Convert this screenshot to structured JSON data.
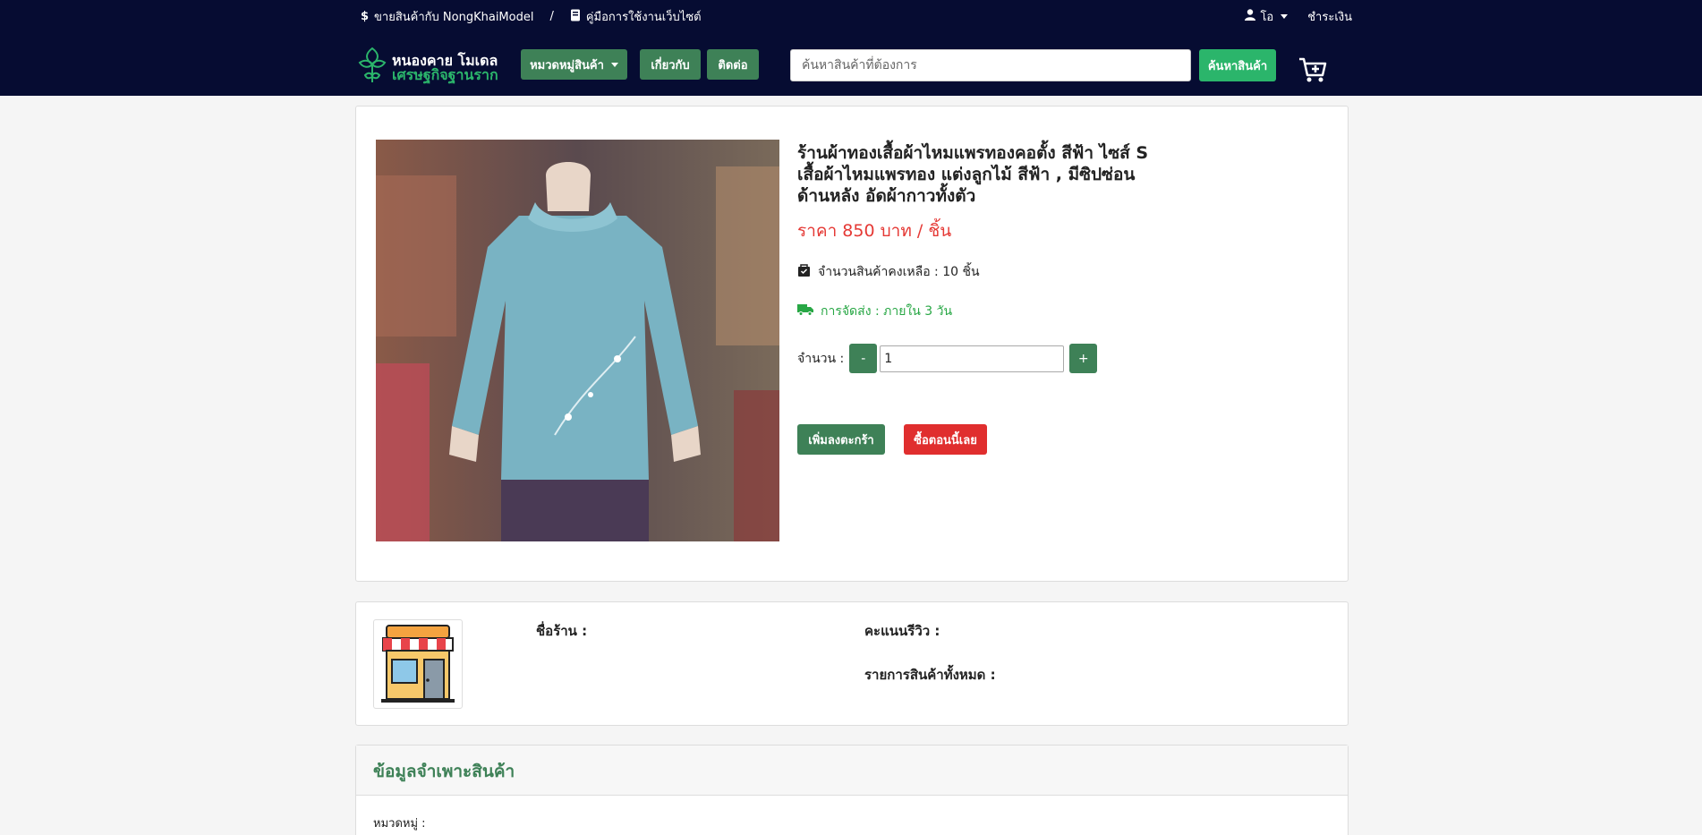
{
  "topbar": {
    "sell_label": "ขายสินค้ากับ NongKhaiModel",
    "separator": "/",
    "manual_label": "คู่มือการใช้งานเว็บไซต์",
    "user_label": "โอ",
    "checkout_label": "ชำระเงิน"
  },
  "logo": {
    "line1": "หนองคาย โมเดล",
    "line2": "เศรษฐกิจฐานราก"
  },
  "nav": {
    "category_label": "หมวดหมู่สินค้า",
    "about_label": "เกี่ยวกับ",
    "contact_label": "ติดต่อ",
    "search_placeholder": "ค้นหาสินค้าที่ต้องการ",
    "search_button": "ค้นหาสินค้า"
  },
  "product": {
    "title_line1": "ร้านผ้าทองเสื้อผ้าไหมแพรทองคอตั้ง สีฟ้า ไซส์ S",
    "title_line2": "เสื้อผ้าไหมแพรทอง แต่งลูกไม้ สีฟ้า , มีซิปซ่อน",
    "title_line3": "ด้านหลัง อัดผ้ากาวทั้งตัว",
    "price": "ราคา 850 บาท / ชิ้น",
    "stock": "จำนวนสินค้าคงเหลือ : 10 ชิ้น",
    "shipping": "การจัดส่ง : ภายใน 3 วัน",
    "qty_label": "จำนวน :",
    "qty_minus": "-",
    "qty_value": "1",
    "qty_plus": "+",
    "add_to_cart": "เพิ่มลงตะกร้า",
    "buy_now": "ซื้อตอนนี้เลย",
    "image_icon": "blouse-photo"
  },
  "shop": {
    "name_label": "ชื่อร้าน :",
    "rating_label": "คะแนนรีวิว :",
    "products_label": "รายการสินค้าทั้งหมด :",
    "icon": "storefront-icon"
  },
  "specs": {
    "title": "ข้อมูลจำเพาะสินค้า",
    "category_label": "หมวดหมู่ :"
  },
  "colors": {
    "navbar": "#060c32",
    "green": "#3e8157",
    "bright_green": "#2bb56b",
    "price_red": "#e53935",
    "buy_red": "#e02e2e"
  }
}
